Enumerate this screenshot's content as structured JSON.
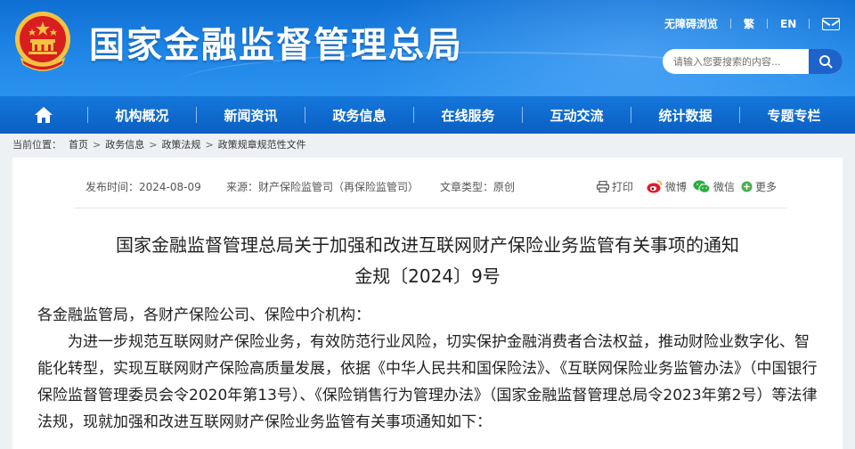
{
  "header": {
    "site_title": "国家金融监督管理总局",
    "top_links": [
      "无障碍浏览",
      "繁",
      "EN"
    ],
    "search_placeholder": "请输入您要搜索的内容...",
    "colors": {
      "header_blue": "#1a7fe0",
      "nav_blue": "#0a63c6",
      "emblem_red": "#d81e1e",
      "emblem_gold": "#f5c242"
    }
  },
  "nav": {
    "home_icon": "home-icon",
    "items": [
      "机构概况",
      "新闻资讯",
      "政务信息",
      "在线服务",
      "互动交流",
      "统计数据",
      "专题专栏"
    ]
  },
  "breadcrumb": {
    "prefix": "当前位置：",
    "items": [
      "首页",
      "政务信息",
      "政策法规",
      "政策规章规范性文件"
    ]
  },
  "article": {
    "publish_time": "发布时间：2024-08-09",
    "source": "来源：财产保险监管司（再保险监管司）",
    "type": "文章类型：原创",
    "share": {
      "print": "打印",
      "weibo": "微博",
      "wechat": "微信",
      "more": "更多"
    },
    "title": "国家金融监督管理总局关于加强和改进互联网财产保险业务监管有关事项的通知",
    "number": "金规〔2024〕9号",
    "salutation": "各金融监管局，各财产保险公司、保险中介机构：",
    "paragraph": "为进一步规范互联网财产保险业务，有效防范行业风险，切实保护金融消费者合法权益，推动财险业数字化、智能化转型，实现互联网财产保险高质量发展，依据《中华人民共和国保险法》、《互联网保险业务监管办法》（中国银行保险监督管理委员会令2020年第13号）、《保险销售行为管理办法》（国家金融监督管理总局令2023年第2号）等法律法规，现就加强和改进互联网财产保险业务监管有关事项通知如下："
  }
}
